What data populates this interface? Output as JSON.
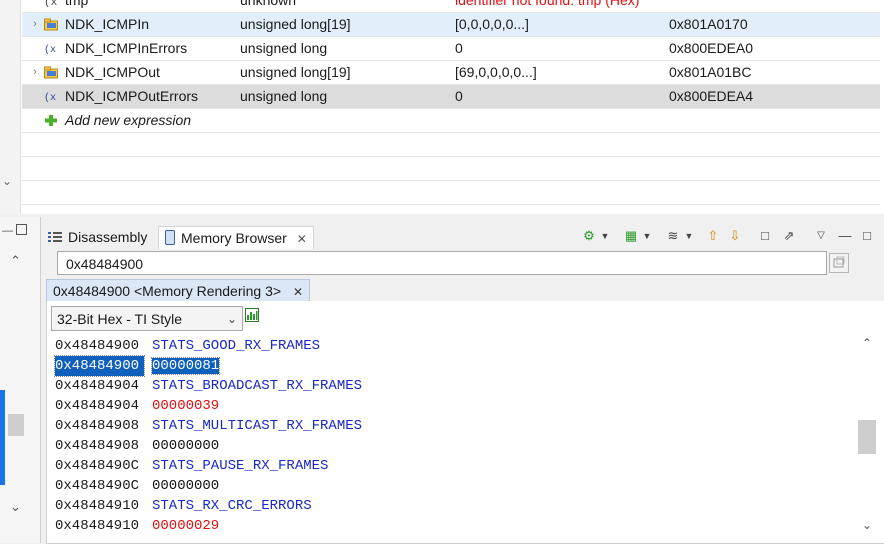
{
  "expressions": {
    "rows": [
      {
        "name": "tmp",
        "type": "unknown",
        "value": "identifier not found: tmp (Hex)",
        "address": "",
        "kind": "partial"
      },
      {
        "name": "NDK_ICMPIn",
        "type": "unsigned long[19]",
        "value": "[0,0,0,0,0...]",
        "address": "0x801A0170",
        "kind": "array",
        "selected": true
      },
      {
        "name": "NDK_ICMPInErrors",
        "type": "unsigned long",
        "value": "0",
        "address": "0x800EDEA0",
        "kind": "var"
      },
      {
        "name": "NDK_ICMPOut",
        "type": "unsigned long[19]",
        "value": "[69,0,0,0,0...]",
        "address": "0x801A01BC",
        "kind": "array"
      },
      {
        "name": "NDK_ICMPOutErrors",
        "type": "unsigned long",
        "value": "0",
        "address": "0x800EDEA4",
        "kind": "var",
        "gray": true
      }
    ],
    "add_new": "Add new expression"
  },
  "tabs": {
    "disassembly": "Disassembly",
    "memory_browser": "Memory Browser"
  },
  "memory": {
    "address_input": "0x48484900",
    "rendering_tab": "0x48484900 <Memory Rendering 3>",
    "format": "32-Bit Hex - TI Style",
    "lines": [
      {
        "addr": "0x48484900",
        "text": "STATS_GOOD_RX_FRAMES",
        "kind": "sym"
      },
      {
        "addr": "0x48484900",
        "text": "00000081",
        "kind": "highlight"
      },
      {
        "addr": "0x48484904",
        "text": "STATS_BROADCAST_RX_FRAMES",
        "kind": "sym"
      },
      {
        "addr": "0x48484904",
        "text": "00000039",
        "kind": "nonzero"
      },
      {
        "addr": "0x48484908",
        "text": "STATS_MULTICAST_RX_FRAMES",
        "kind": "sym"
      },
      {
        "addr": "0x48484908",
        "text": "00000000",
        "kind": "zero"
      },
      {
        "addr": "0x4848490C",
        "text": "STATS_PAUSE_RX_FRAMES",
        "kind": "sym"
      },
      {
        "addr": "0x4848490C",
        "text": "00000000",
        "kind": "zero"
      },
      {
        "addr": "0x48484910",
        "text": "STATS_RX_CRC_ERRORS",
        "kind": "sym"
      },
      {
        "addr": "0x48484910",
        "text": "00000029",
        "kind": "nonzero"
      }
    ]
  },
  "colors": {
    "symbol": "#1a28c8",
    "nonzero": "#e01010",
    "selection": "#0f5fbd"
  }
}
